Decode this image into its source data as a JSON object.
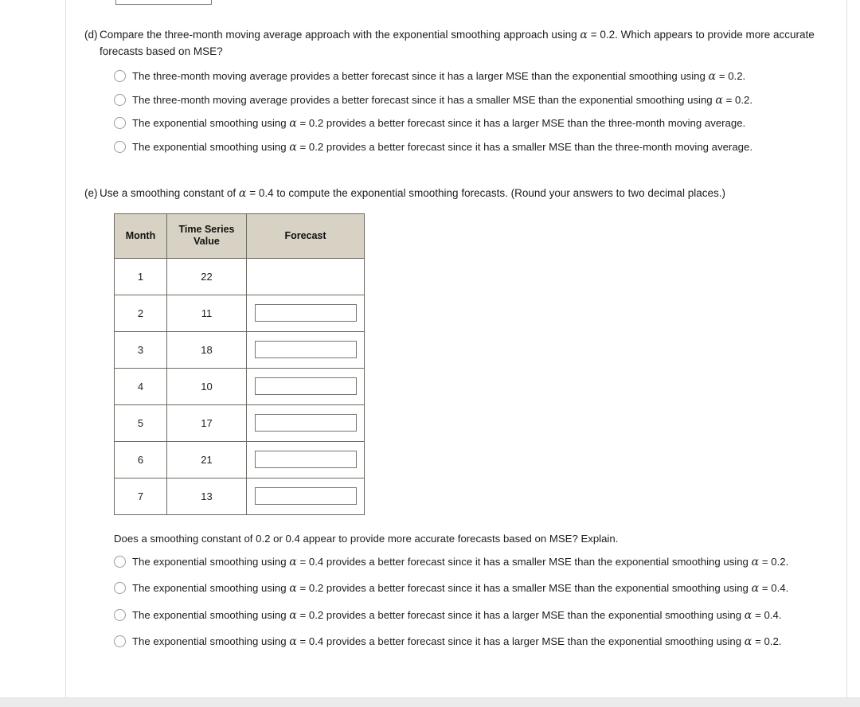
{
  "document": {
    "alpha_symbol": "α"
  },
  "question_d": {
    "label": "(d)",
    "prompt_part1": "Compare the three-month moving average approach with the exponential smoothing approach using ",
    "prompt_alpha_value": " = 0.2. Which appears to provide more accurate forecasts based on MSE?",
    "options": [
      {
        "id": "d-opt-1",
        "text_before_alpha": "The three-month moving average provides a better forecast since it has a larger MSE than the exponential smoothing using ",
        "text_after_alpha": " = 0.2.",
        "selected": false
      },
      {
        "id": "d-opt-2",
        "text_before_alpha": "The three-month moving average provides a better forecast since it has a smaller MSE than the exponential smoothing using ",
        "text_after_alpha": " = 0.2.",
        "selected": false
      },
      {
        "id": "d-opt-3",
        "text_before_alpha": "The exponential smoothing using ",
        "text_after_alpha": " = 0.2 provides a better forecast since it has a larger MSE than the three-month moving average.",
        "selected": false
      },
      {
        "id": "d-opt-4",
        "text_before_alpha": "The exponential smoothing using ",
        "text_after_alpha": " = 0.2 provides a better forecast since it has a smaller MSE than the three-month moving average.",
        "selected": false
      }
    ]
  },
  "question_e": {
    "label": "(e)",
    "prompt_part1": "Use a smoothing constant of ",
    "prompt_alpha_value": " = 0.4 to compute the exponential smoothing forecasts. (Round your answers to two decimal places.)",
    "table": {
      "headers": [
        "Month",
        "Time Series Value",
        "Forecast"
      ],
      "header_lines": [
        [
          "Month"
        ],
        [
          "Time Series",
          "Value"
        ],
        [
          "Forecast"
        ]
      ],
      "rows": [
        {
          "month": "1",
          "value": "22",
          "forecast": "",
          "has_input": false
        },
        {
          "month": "2",
          "value": "11",
          "forecast": "",
          "has_input": true
        },
        {
          "month": "3",
          "value": "18",
          "forecast": "",
          "has_input": true
        },
        {
          "month": "4",
          "value": "10",
          "forecast": "",
          "has_input": true
        },
        {
          "month": "5",
          "value": "17",
          "forecast": "",
          "has_input": true
        },
        {
          "month": "6",
          "value": "21",
          "forecast": "",
          "has_input": true
        },
        {
          "month": "7",
          "value": "13",
          "forecast": "",
          "has_input": true
        }
      ]
    },
    "subquestion": "Does a smoothing constant of 0.2 or 0.4 appear to provide more accurate forecasts based on MSE? Explain.",
    "options": [
      {
        "id": "e-opt-1",
        "text_before_alpha": "The exponential smoothing using ",
        "text_mid": " = 0.4 provides a better forecast since it has a smaller MSE than the exponential smoothing using ",
        "text_after_alpha": " = 0.2.",
        "selected": false
      },
      {
        "id": "e-opt-2",
        "text_before_alpha": "The exponential smoothing using ",
        "text_mid": " = 0.2 provides a better forecast since it has a smaller MSE than the exponential smoothing using ",
        "text_after_alpha": " = 0.4.",
        "selected": false
      },
      {
        "id": "e-opt-3",
        "text_before_alpha": "The exponential smoothing using ",
        "text_mid": " = 0.2 provides a better forecast since it has a larger MSE than the exponential smoothing using ",
        "text_after_alpha": " = 0.4.",
        "selected": false
      },
      {
        "id": "e-opt-4",
        "text_before_alpha": "The exponential smoothing using ",
        "text_mid": " = 0.4 provides a better forecast since it has a larger MSE than the exponential smoothing using ",
        "text_after_alpha": " = 0.2.",
        "selected": false
      }
    ]
  },
  "colors": {
    "header_background": "#d7d2c4",
    "value_text": "#9d3b3b",
    "table_border": "#6d6a63",
    "body_text": "#1d1d1d",
    "input_border": "#767676"
  }
}
